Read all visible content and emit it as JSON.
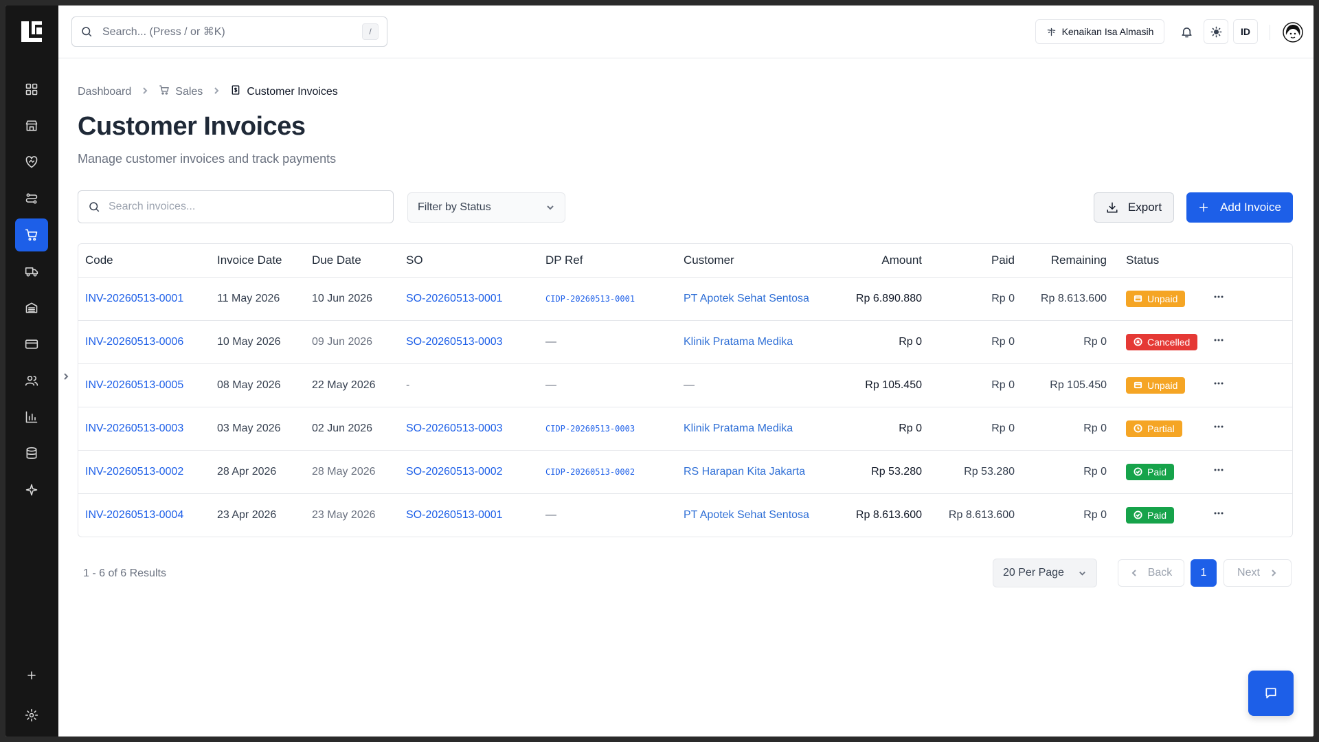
{
  "topbar": {
    "search_placeholder": "Search... (Press / or ⌘K)",
    "search_shortcut": "/",
    "holiday_label": "Kenaikan Isa Almasih",
    "language": "ID"
  },
  "breadcrumb": {
    "home": "Dashboard",
    "section": "Sales",
    "current": "Customer Invoices"
  },
  "page": {
    "title": "Customer Invoices",
    "subtitle": "Manage customer invoices and track payments"
  },
  "toolbar": {
    "search_placeholder": "Search invoices...",
    "filter_label": "Filter by Status",
    "export_label": "Export",
    "add_label": "Add Invoice"
  },
  "table": {
    "headers": {
      "code": "Code",
      "invoice_date": "Invoice Date",
      "due_date": "Due Date",
      "so": "SO",
      "dp_ref": "DP Ref",
      "customer": "Customer",
      "amount": "Amount",
      "paid": "Paid",
      "remaining": "Remaining",
      "status": "Status"
    },
    "rows": [
      {
        "code": "INV-20260513-0001",
        "invoice_date": "11 May 2026",
        "due_date": "10 Jun 2026",
        "so": "SO-20260513-0001",
        "dp_ref": "CIDP-20260513-0001",
        "customer": "PT Apotek Sehat Sentosa",
        "amount": "Rp 6.890.880",
        "paid": "Rp 0",
        "remaining": "Rp 8.613.600",
        "status": "Unpaid"
      },
      {
        "code": "INV-20260513-0006",
        "invoice_date": "10 May 2026",
        "due_date": "09 Jun 2026",
        "so": "SO-20260513-0003",
        "dp_ref": "—",
        "customer": "Klinik Pratama Medika",
        "amount": "Rp 0",
        "paid": "Rp 0",
        "remaining": "Rp 0",
        "status": "Cancelled"
      },
      {
        "code": "INV-20260513-0005",
        "invoice_date": "08 May 2026",
        "due_date": "22 May 2026",
        "so": "-",
        "dp_ref": "—",
        "customer": "—",
        "amount": "Rp 105.450",
        "paid": "Rp 0",
        "remaining": "Rp 105.450",
        "status": "Unpaid"
      },
      {
        "code": "INV-20260513-0003",
        "invoice_date": "03 May 2026",
        "due_date": "02 Jun 2026",
        "so": "SO-20260513-0003",
        "dp_ref": "CIDP-20260513-0003",
        "customer": "Klinik Pratama Medika",
        "amount": "Rp 0",
        "paid": "Rp 0",
        "remaining": "Rp 0",
        "status": "Partial"
      },
      {
        "code": "INV-20260513-0002",
        "invoice_date": "28 Apr 2026",
        "due_date": "28 May 2026",
        "so": "SO-20260513-0002",
        "dp_ref": "CIDP-20260513-0002",
        "customer": "RS Harapan Kita Jakarta",
        "amount": "Rp 53.280",
        "paid": "Rp 53.280",
        "remaining": "Rp 0",
        "status": "Paid"
      },
      {
        "code": "INV-20260513-0004",
        "invoice_date": "23 Apr 2026",
        "due_date": "23 May 2026",
        "so": "SO-20260513-0001",
        "dp_ref": "—",
        "customer": "PT Apotek Sehat Sentosa",
        "amount": "Rp 8.613.600",
        "paid": "Rp 8.613.600",
        "remaining": "Rp 0",
        "status": "Paid"
      }
    ]
  },
  "pagination": {
    "results": "1 - 6 of 6 Results",
    "per_page": "20 Per Page",
    "back": "Back",
    "next": "Next",
    "current_page": "1"
  },
  "colors": {
    "accent": "#1d5fe8",
    "sidebar": "#161616",
    "unpaid": "#f5a524",
    "cancelled": "#e53935",
    "paid": "#16a34a"
  },
  "icons": {
    "sidebar": [
      "dashboard-icon",
      "store-icon",
      "handshake-icon",
      "workflow-icon",
      "cart-icon",
      "truck-icon",
      "warehouse-icon",
      "credit-card-icon",
      "users-icon",
      "bar-chart-icon",
      "database-icon",
      "sparkles-icon",
      "plus-icon",
      "gear-icon"
    ]
  }
}
